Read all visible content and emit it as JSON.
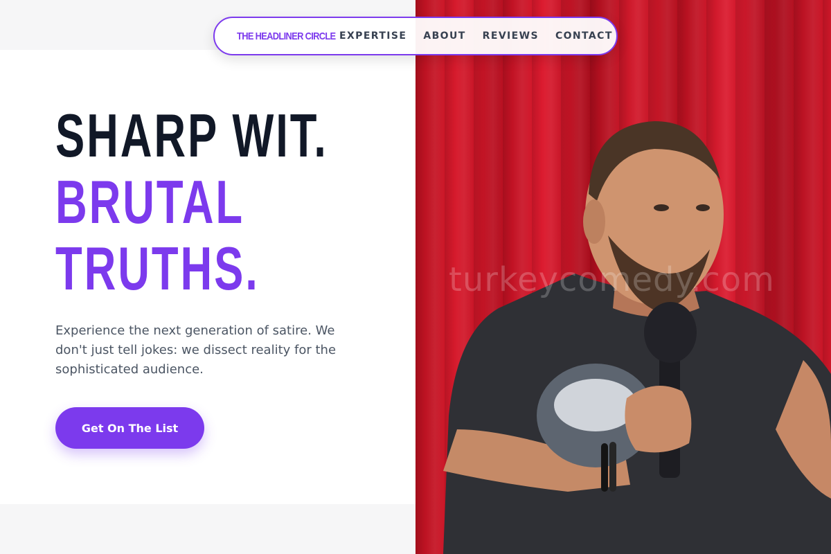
{
  "nav": {
    "brand": "THE HEADLINER CIRCLE",
    "links": [
      "EXPERTISE",
      "ABOUT",
      "REVIEWS",
      "CONTACT"
    ]
  },
  "hero": {
    "headline_line1": "SHARP WIT.",
    "headline_line2": "BRUTAL",
    "headline_line3": "TRUTHS.",
    "subtext": "Experience the next generation of satire. We don't just tell jokes: we dissect reality for the sophisticated audience.",
    "cta_label": "Get On The List"
  },
  "photo": {
    "watermark": "turkeycomedy.com",
    "icon": "comedian-with-microphone-photo"
  },
  "colors": {
    "accent": "#7c3aed",
    "headline_dark": "#111827",
    "body_text": "#4b5563",
    "curtain_red": "#c8142a"
  }
}
